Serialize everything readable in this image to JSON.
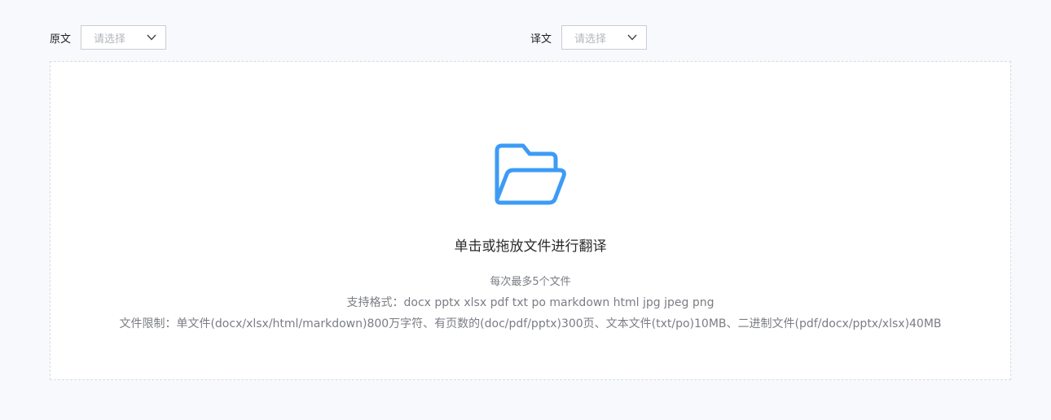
{
  "source": {
    "label": "原文",
    "placeholder": "请选择"
  },
  "target": {
    "label": "译文",
    "placeholder": "请选择"
  },
  "upload": {
    "title": "单击或拖放文件进行翻译",
    "max_files": "每次最多5个文件",
    "supported_formats": "支持格式：docx pptx xlsx pdf txt po markdown html jpg jpeg png",
    "file_limits": "文件限制：单文件(docx/xlsx/html/markdown)800万字符、有页数的(doc/pdf/pptx)300页、文本文件(txt/po)10MB、二进制文件(pdf/docx/pptx/xlsx)40MB"
  },
  "icons": {
    "dropdown": "chevron-down-icon",
    "upload": "folder-open-icon"
  },
  "colors": {
    "accent": "#3d9bf5",
    "background": "#f8f9fc"
  }
}
